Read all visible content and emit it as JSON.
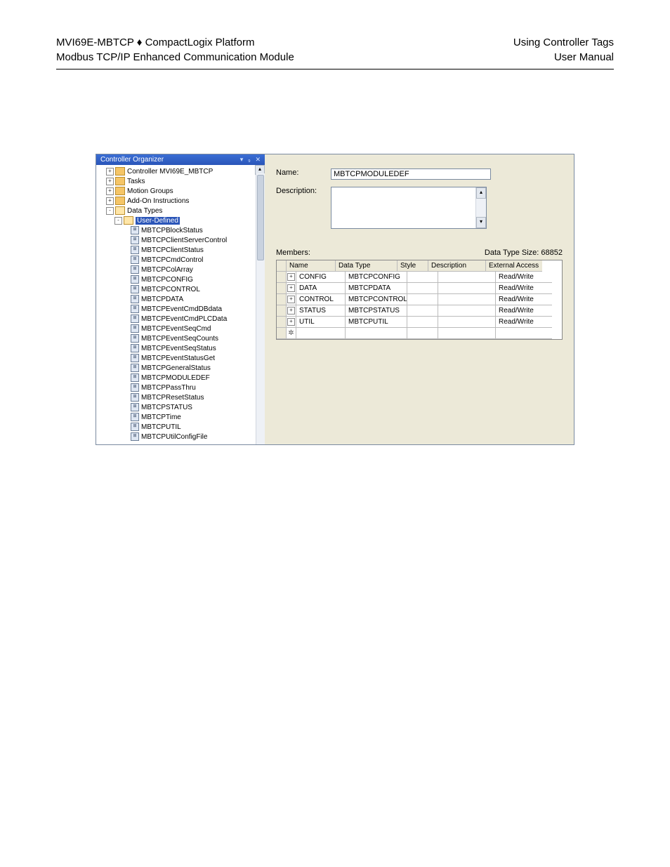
{
  "header": {
    "left1": "MVI69E-MBTCP ♦ CompactLogix Platform",
    "left2": "Modbus TCP/IP Enhanced Communication Module",
    "right1": "Using Controller Tags",
    "right2": "User Manual"
  },
  "tree": {
    "title": "Controller Organizer",
    "top_nodes": [
      {
        "exp": "+",
        "icon": "folder",
        "label": "Controller MVI69E_MBTCP"
      },
      {
        "exp": "+",
        "icon": "folder",
        "label": "Tasks"
      },
      {
        "exp": "+",
        "icon": "folder",
        "label": "Motion Groups"
      },
      {
        "exp": "+",
        "icon": "folder",
        "label": "Add-On Instructions"
      },
      {
        "exp": "-",
        "icon": "folder-open",
        "label": "Data Types"
      }
    ],
    "user_defined_label": "User-Defined",
    "ud_items": [
      "MBTCPBlockStatus",
      "MBTCPClientServerControl",
      "MBTCPClientStatus",
      "MBTCPCmdControl",
      "MBTCPColArray",
      "MBTCPCONFIG",
      "MBTCPCONTROL",
      "MBTCPDATA",
      "MBTCPEventCmdDBdata",
      "MBTCPEventCmdPLCData",
      "MBTCPEventSeqCmd",
      "MBTCPEventSeqCounts",
      "MBTCPEventSeqStatus",
      "MBTCPEventStatusGet",
      "MBTCPGeneralStatus",
      "MBTCPMODULEDEF",
      "MBTCPPassThru",
      "MBTCPResetStatus",
      "MBTCPSTATUS",
      "MBTCPTime",
      "MBTCPUTIL",
      "MBTCPUtilConfigFile"
    ]
  },
  "form": {
    "name_label": "Name:",
    "name_value": "MBTCPMODULEDEF",
    "desc_label": "Description:",
    "members_label": "Members:",
    "size_label": "Data Type Size: 68852"
  },
  "grid": {
    "headers": {
      "name": "Name",
      "type": "Data Type",
      "style": "Style",
      "desc": "Description",
      "ext": "External Access"
    },
    "rows": [
      {
        "name": "CONFIG",
        "type": "MBTCPCONFIG",
        "style": "",
        "desc": "",
        "ext": "Read/Write"
      },
      {
        "name": "DATA",
        "type": "MBTCPDATA",
        "style": "",
        "desc": "",
        "ext": "Read/Write"
      },
      {
        "name": "CONTROL",
        "type": "MBTCPCONTROL",
        "style": "",
        "desc": "",
        "ext": "Read/Write"
      },
      {
        "name": "STATUS",
        "type": "MBTCPSTATUS",
        "style": "",
        "desc": "",
        "ext": "Read/Write"
      },
      {
        "name": "UTIL",
        "type": "MBTCPUTIL",
        "style": "",
        "desc": "",
        "ext": "Read/Write"
      }
    ]
  }
}
